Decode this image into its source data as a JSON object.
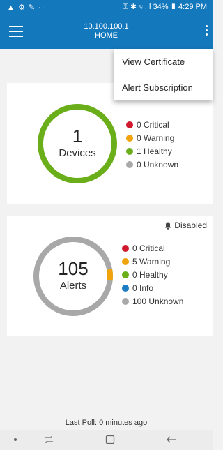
{
  "status_bar": {
    "left_icons": "▲ ⚙ ✎ ··",
    "right_text": "⚿ ✱ ≋ .ıl 34% ▮ 4:29 PM"
  },
  "app_bar": {
    "host": "10.100.100.1",
    "section": "HOME"
  },
  "menu": {
    "items": [
      {
        "label": "View Certificate"
      },
      {
        "label": "Alert Subscription"
      }
    ]
  },
  "devices_card": {
    "count": "1",
    "label": "Devices",
    "legend": [
      {
        "text": "0 Critical",
        "color": "#d0192c",
        "value": 0
      },
      {
        "text": "0 Warning",
        "color": "#f0a30a",
        "value": 0
      },
      {
        "text": "1 Healthy",
        "color": "#6aae1a",
        "value": 1
      },
      {
        "text": "0 Unknown",
        "color": "#a8a8a8",
        "value": 0
      }
    ]
  },
  "alerts_card": {
    "disabled_label": "Disabled",
    "count": "105",
    "label": "Alerts",
    "legend": [
      {
        "text": "0 Critical",
        "color": "#d0192c",
        "value": 0
      },
      {
        "text": "5 Warning",
        "color": "#f0a30a",
        "value": 5
      },
      {
        "text": "0 Healthy",
        "color": "#6aae1a",
        "value": 0
      },
      {
        "text": "0 Info",
        "color": "#1c7cc4",
        "value": 0
      },
      {
        "text": "100 Unknown",
        "color": "#a8a8a8",
        "value": 100
      }
    ]
  },
  "footer": {
    "last_poll": "Last Poll: 0 minutes ago"
  },
  "colors": {
    "brand": "#1478bd",
    "healthy": "#6aae1a",
    "warning": "#f0a30a",
    "unknown": "#a8a8a8"
  }
}
